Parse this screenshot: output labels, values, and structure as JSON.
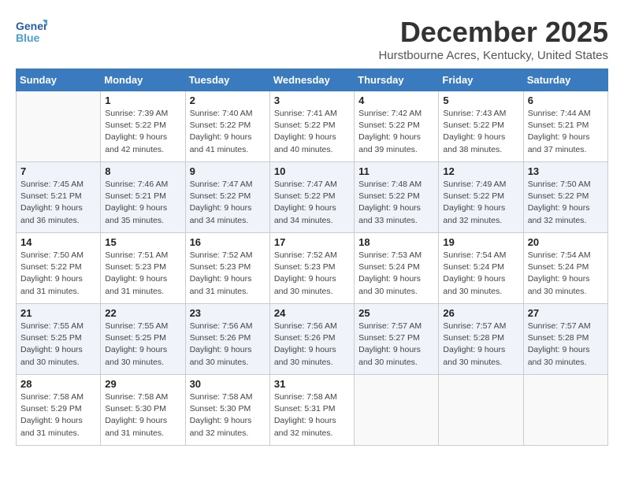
{
  "logo": {
    "line1": "General",
    "line2": "Blue"
  },
  "title": "December 2025",
  "subtitle": "Hurstbourne Acres, Kentucky, United States",
  "weekdays": [
    "Sunday",
    "Monday",
    "Tuesday",
    "Wednesday",
    "Thursday",
    "Friday",
    "Saturday"
  ],
  "weeks": [
    [
      {
        "day": "",
        "sunrise": "",
        "sunset": "",
        "daylight": ""
      },
      {
        "day": "1",
        "sunrise": "Sunrise: 7:39 AM",
        "sunset": "Sunset: 5:22 PM",
        "daylight": "Daylight: 9 hours and 42 minutes."
      },
      {
        "day": "2",
        "sunrise": "Sunrise: 7:40 AM",
        "sunset": "Sunset: 5:22 PM",
        "daylight": "Daylight: 9 hours and 41 minutes."
      },
      {
        "day": "3",
        "sunrise": "Sunrise: 7:41 AM",
        "sunset": "Sunset: 5:22 PM",
        "daylight": "Daylight: 9 hours and 40 minutes."
      },
      {
        "day": "4",
        "sunrise": "Sunrise: 7:42 AM",
        "sunset": "Sunset: 5:22 PM",
        "daylight": "Daylight: 9 hours and 39 minutes."
      },
      {
        "day": "5",
        "sunrise": "Sunrise: 7:43 AM",
        "sunset": "Sunset: 5:22 PM",
        "daylight": "Daylight: 9 hours and 38 minutes."
      },
      {
        "day": "6",
        "sunrise": "Sunrise: 7:44 AM",
        "sunset": "Sunset: 5:21 PM",
        "daylight": "Daylight: 9 hours and 37 minutes."
      }
    ],
    [
      {
        "day": "7",
        "sunrise": "Sunrise: 7:45 AM",
        "sunset": "Sunset: 5:21 PM",
        "daylight": "Daylight: 9 hours and 36 minutes."
      },
      {
        "day": "8",
        "sunrise": "Sunrise: 7:46 AM",
        "sunset": "Sunset: 5:21 PM",
        "daylight": "Daylight: 9 hours and 35 minutes."
      },
      {
        "day": "9",
        "sunrise": "Sunrise: 7:47 AM",
        "sunset": "Sunset: 5:22 PM",
        "daylight": "Daylight: 9 hours and 34 minutes."
      },
      {
        "day": "10",
        "sunrise": "Sunrise: 7:47 AM",
        "sunset": "Sunset: 5:22 PM",
        "daylight": "Daylight: 9 hours and 34 minutes."
      },
      {
        "day": "11",
        "sunrise": "Sunrise: 7:48 AM",
        "sunset": "Sunset: 5:22 PM",
        "daylight": "Daylight: 9 hours and 33 minutes."
      },
      {
        "day": "12",
        "sunrise": "Sunrise: 7:49 AM",
        "sunset": "Sunset: 5:22 PM",
        "daylight": "Daylight: 9 hours and 32 minutes."
      },
      {
        "day": "13",
        "sunrise": "Sunrise: 7:50 AM",
        "sunset": "Sunset: 5:22 PM",
        "daylight": "Daylight: 9 hours and 32 minutes."
      }
    ],
    [
      {
        "day": "14",
        "sunrise": "Sunrise: 7:50 AM",
        "sunset": "Sunset: 5:22 PM",
        "daylight": "Daylight: 9 hours and 31 minutes."
      },
      {
        "day": "15",
        "sunrise": "Sunrise: 7:51 AM",
        "sunset": "Sunset: 5:23 PM",
        "daylight": "Daylight: 9 hours and 31 minutes."
      },
      {
        "day": "16",
        "sunrise": "Sunrise: 7:52 AM",
        "sunset": "Sunset: 5:23 PM",
        "daylight": "Daylight: 9 hours and 31 minutes."
      },
      {
        "day": "17",
        "sunrise": "Sunrise: 7:52 AM",
        "sunset": "Sunset: 5:23 PM",
        "daylight": "Daylight: 9 hours and 30 minutes."
      },
      {
        "day": "18",
        "sunrise": "Sunrise: 7:53 AM",
        "sunset": "Sunset: 5:24 PM",
        "daylight": "Daylight: 9 hours and 30 minutes."
      },
      {
        "day": "19",
        "sunrise": "Sunrise: 7:54 AM",
        "sunset": "Sunset: 5:24 PM",
        "daylight": "Daylight: 9 hours and 30 minutes."
      },
      {
        "day": "20",
        "sunrise": "Sunrise: 7:54 AM",
        "sunset": "Sunset: 5:24 PM",
        "daylight": "Daylight: 9 hours and 30 minutes."
      }
    ],
    [
      {
        "day": "21",
        "sunrise": "Sunrise: 7:55 AM",
        "sunset": "Sunset: 5:25 PM",
        "daylight": "Daylight: 9 hours and 30 minutes."
      },
      {
        "day": "22",
        "sunrise": "Sunrise: 7:55 AM",
        "sunset": "Sunset: 5:25 PM",
        "daylight": "Daylight: 9 hours and 30 minutes."
      },
      {
        "day": "23",
        "sunrise": "Sunrise: 7:56 AM",
        "sunset": "Sunset: 5:26 PM",
        "daylight": "Daylight: 9 hours and 30 minutes."
      },
      {
        "day": "24",
        "sunrise": "Sunrise: 7:56 AM",
        "sunset": "Sunset: 5:26 PM",
        "daylight": "Daylight: 9 hours and 30 minutes."
      },
      {
        "day": "25",
        "sunrise": "Sunrise: 7:57 AM",
        "sunset": "Sunset: 5:27 PM",
        "daylight": "Daylight: 9 hours and 30 minutes."
      },
      {
        "day": "26",
        "sunrise": "Sunrise: 7:57 AM",
        "sunset": "Sunset: 5:28 PM",
        "daylight": "Daylight: 9 hours and 30 minutes."
      },
      {
        "day": "27",
        "sunrise": "Sunrise: 7:57 AM",
        "sunset": "Sunset: 5:28 PM",
        "daylight": "Daylight: 9 hours and 30 minutes."
      }
    ],
    [
      {
        "day": "28",
        "sunrise": "Sunrise: 7:58 AM",
        "sunset": "Sunset: 5:29 PM",
        "daylight": "Daylight: 9 hours and 31 minutes."
      },
      {
        "day": "29",
        "sunrise": "Sunrise: 7:58 AM",
        "sunset": "Sunset: 5:30 PM",
        "daylight": "Daylight: 9 hours and 31 minutes."
      },
      {
        "day": "30",
        "sunrise": "Sunrise: 7:58 AM",
        "sunset": "Sunset: 5:30 PM",
        "daylight": "Daylight: 9 hours and 32 minutes."
      },
      {
        "day": "31",
        "sunrise": "Sunrise: 7:58 AM",
        "sunset": "Sunset: 5:31 PM",
        "daylight": "Daylight: 9 hours and 32 minutes."
      },
      {
        "day": "",
        "sunrise": "",
        "sunset": "",
        "daylight": ""
      },
      {
        "day": "",
        "sunrise": "",
        "sunset": "",
        "daylight": ""
      },
      {
        "day": "",
        "sunrise": "",
        "sunset": "",
        "daylight": ""
      }
    ]
  ],
  "colors": {
    "header_bg": "#3a7abf",
    "header_text": "#ffffff",
    "row_even_bg": "#f0f4fa",
    "row_odd_bg": "#ffffff",
    "accent": "#2a5aa8"
  }
}
